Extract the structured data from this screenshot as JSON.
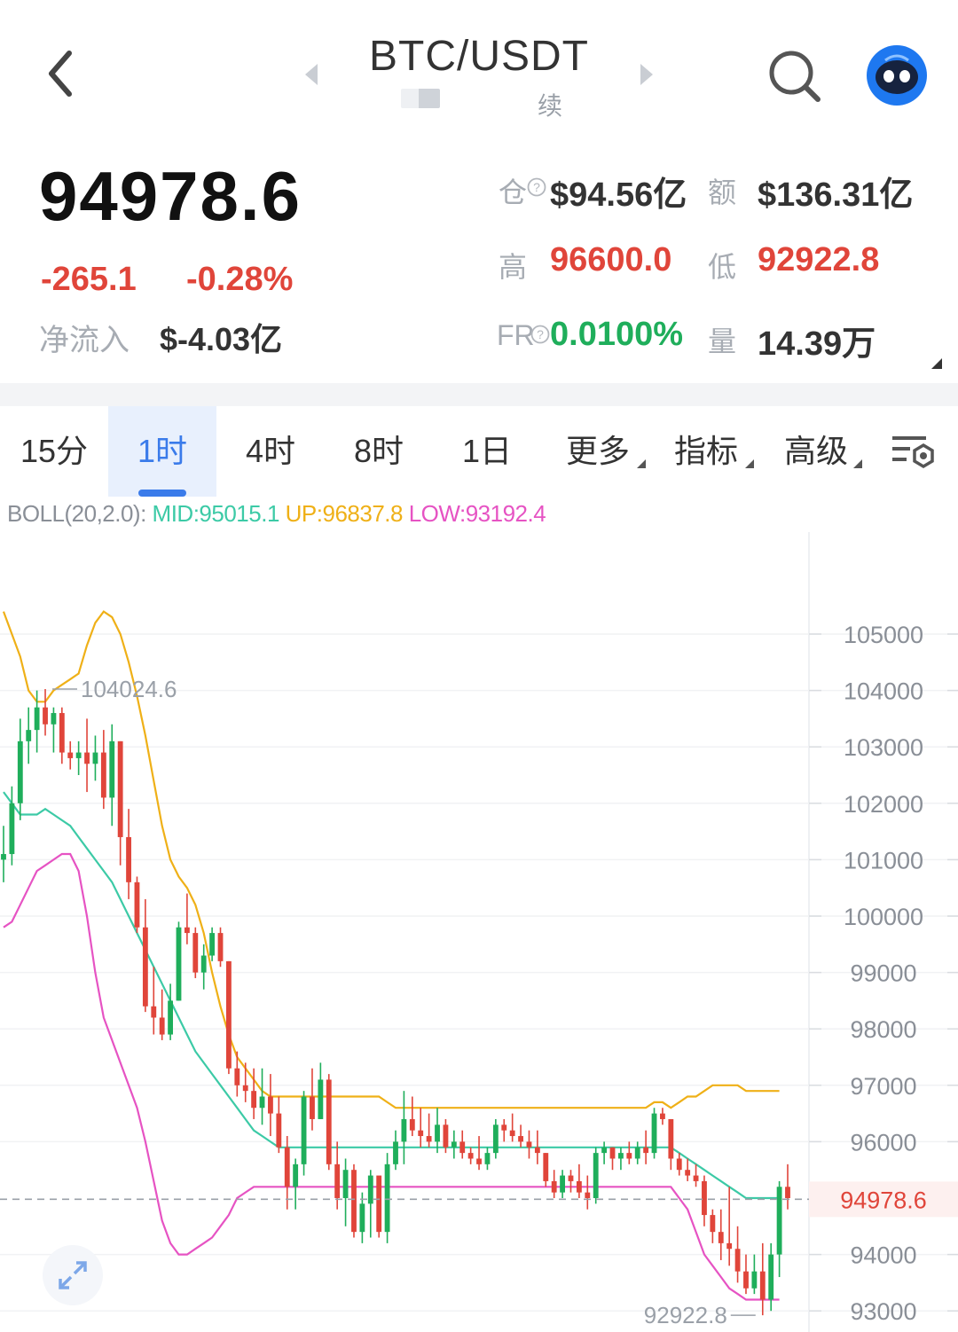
{
  "header": {
    "pair": "BTC/USDT",
    "sub_label": "续",
    "icons": {
      "back": "back-chevron-icon",
      "prev": "caret-left-icon",
      "next": "caret-right-icon",
      "search": "search-icon",
      "assistant": "robot-assistant-icon"
    }
  },
  "ticker": {
    "price": "94978.6",
    "change": "-265.1",
    "change_pct": "-0.28%",
    "inflow_label": "净流入",
    "inflow_value": "$-4.03亿",
    "oi_label": "仓",
    "oi_value": "$94.56亿",
    "amount_label": "额",
    "amount_value": "$136.31亿",
    "high_label": "高",
    "high_value": "96600.0",
    "low_label": "低",
    "low_value": "92922.8",
    "fr_label": "FR",
    "fr_value": "0.0100%",
    "vol_label": "量",
    "vol_value": "14.39万"
  },
  "tabs": [
    {
      "label": "15分"
    },
    {
      "label": "1时",
      "active": true
    },
    {
      "label": "4时"
    },
    {
      "label": "8时"
    },
    {
      "label": "1日"
    },
    {
      "label": "更多"
    },
    {
      "label": "指标"
    },
    {
      "label": "高级"
    }
  ],
  "indicator": {
    "name": "BOLL(20,2.0):",
    "mid": "MID:95015.1",
    "up": "UP:96837.8",
    "low": "LOW:93192.4"
  },
  "colors": {
    "up": "#1fae5b",
    "down": "#e0453a",
    "mid": "#3ccaa6",
    "upper": "#efb017",
    "lower": "#e653c3",
    "accent": "#3a7bea"
  },
  "chart_data": {
    "type": "candlestick",
    "y_ticks": [
      "105000",
      "104000",
      "103000",
      "102000",
      "101000",
      "100000",
      "99000",
      "98000",
      "97000",
      "96000",
      "94000",
      "93000"
    ],
    "ylim": [
      92800,
      105700
    ],
    "last_price_label": "94978.6",
    "last_price": 94978.6,
    "max_label": "104024.6",
    "max_value": 104024.6,
    "min_label": "92922.8",
    "min_value": 92922.8,
    "candles": [
      [
        101000,
        101600,
        100600,
        101100
      ],
      [
        101100,
        102300,
        100900,
        102000
      ],
      [
        102000,
        103500,
        101700,
        103100
      ],
      [
        103100,
        103700,
        102700,
        103300
      ],
      [
        103300,
        104000,
        102900,
        103700
      ],
      [
        103700,
        104024.6,
        103200,
        103400
      ],
      [
        103400,
        103700,
        102900,
        103600
      ],
      [
        103600,
        103700,
        102700,
        102900
      ],
      [
        102900,
        103100,
        102600,
        102800
      ],
      [
        102800,
        103100,
        102500,
        102900
      ],
      [
        102900,
        103500,
        102200,
        102700
      ],
      [
        102700,
        103200,
        102400,
        102900
      ],
      [
        102900,
        103300,
        101900,
        102100
      ],
      [
        102100,
        103400,
        101600,
        103100
      ],
      [
        103100,
        103100,
        100900,
        101400
      ],
      [
        101400,
        101900,
        100300,
        100600
      ],
      [
        100600,
        100700,
        99700,
        99800
      ],
      [
        99800,
        100300,
        98300,
        98400
      ],
      [
        98400,
        99100,
        97900,
        98200
      ],
      [
        98200,
        98700,
        97800,
        97900
      ],
      [
        97900,
        98800,
        97800,
        98500
      ],
      [
        98500,
        99900,
        98500,
        99800
      ],
      [
        99800,
        100400,
        99500,
        99700
      ],
      [
        99700,
        99800,
        98900,
        99000
      ],
      [
        99000,
        99500,
        98700,
        99300
      ],
      [
        99300,
        99800,
        99200,
        99700
      ],
      [
        99700,
        99800,
        99100,
        99200
      ],
      [
        99200,
        99200,
        97200,
        97300
      ],
      [
        97300,
        97600,
        96800,
        97000
      ],
      [
        97000,
        97400,
        96700,
        96900
      ],
      [
        96900,
        97300,
        96400,
        96600
      ],
      [
        96600,
        97300,
        96300,
        96800
      ],
      [
        96800,
        97200,
        96100,
        96500
      ],
      [
        96500,
        96800,
        95800,
        95900
      ],
      [
        95900,
        96100,
        94800,
        95200
      ],
      [
        95200,
        95700,
        94800,
        95600
      ],
      [
        95600,
        96900,
        95400,
        96800
      ],
      [
        96800,
        97300,
        96200,
        96400
      ],
      [
        96400,
        97400,
        96400,
        97100
      ],
      [
        97100,
        97200,
        95500,
        95600
      ],
      [
        95600,
        96000,
        94800,
        95000
      ],
      [
        95000,
        95700,
        94500,
        95500
      ],
      [
        95500,
        95600,
        94300,
        94400
      ],
      [
        94400,
        95100,
        94200,
        94900
      ],
      [
        94900,
        95500,
        94300,
        95400
      ],
      [
        95400,
        95300,
        94300,
        94400
      ],
      [
        94400,
        95800,
        94200,
        95600
      ],
      [
        95600,
        96200,
        95500,
        96000
      ],
      [
        96000,
        96900,
        95600,
        96400
      ],
      [
        96400,
        96800,
        96100,
        96200
      ],
      [
        96200,
        96600,
        95900,
        96100
      ],
      [
        96100,
        96500,
        95900,
        96000
      ],
      [
        96000,
        96600,
        95800,
        96300
      ],
      [
        96300,
        96400,
        95800,
        95900
      ],
      [
        95900,
        96200,
        95700,
        96000
      ],
      [
        96000,
        96200,
        95700,
        95800
      ],
      [
        95800,
        95900,
        95600,
        95700
      ],
      [
        95700,
        96100,
        95500,
        95600
      ],
      [
        95600,
        95900,
        95500,
        95800
      ],
      [
        95800,
        96400,
        95700,
        96300
      ],
      [
        96300,
        96400,
        96000,
        96200
      ],
      [
        96200,
        96500,
        96000,
        96100
      ],
      [
        96100,
        96300,
        95900,
        96000
      ],
      [
        96000,
        96200,
        95700,
        95900
      ],
      [
        95900,
        96200,
        95600,
        95800
      ],
      [
        95800,
        95800,
        95200,
        95300
      ],
      [
        95300,
        95500,
        95000,
        95100
      ],
      [
        95100,
        95500,
        95000,
        95400
      ],
      [
        95400,
        95500,
        95100,
        95300
      ],
      [
        95300,
        95600,
        95000,
        95100
      ],
      [
        95100,
        95400,
        94800,
        95000
      ],
      [
        95000,
        95900,
        94900,
        95800
      ],
      [
        95800,
        96000,
        95600,
        95900
      ],
      [
        95900,
        95900,
        95500,
        95700
      ],
      [
        95700,
        95900,
        95500,
        95800
      ],
      [
        95800,
        96000,
        95600,
        95700
      ],
      [
        95700,
        96000,
        95600,
        95900
      ],
      [
        95900,
        96200,
        95600,
        95800
      ],
      [
        95800,
        96600,
        95700,
        96500
      ],
      [
        96500,
        96600,
        96300,
        96400
      ],
      [
        96400,
        96400,
        95500,
        95700
      ],
      [
        95700,
        95800,
        95400,
        95500
      ],
      [
        95500,
        95700,
        95300,
        95400
      ],
      [
        95400,
        95600,
        95200,
        95300
      ],
      [
        95300,
        95400,
        94500,
        94700
      ],
      [
        94700,
        94800,
        94200,
        94400
      ],
      [
        94400,
        94800,
        93900,
        94200
      ],
      [
        94200,
        95200,
        93800,
        94100
      ],
      [
        94100,
        94500,
        93500,
        93700
      ],
      [
        93700,
        94000,
        93300,
        93400
      ],
      [
        93400,
        94000,
        93300,
        93700
      ],
      [
        93700,
        94200,
        92922.8,
        93200
      ],
      [
        93200,
        94200,
        93000,
        94000
      ],
      [
        94000,
        95300,
        93600,
        95200
      ],
      [
        95200,
        95600,
        94800,
        95000
      ]
    ],
    "mid": [
      102200,
      102000,
      101800,
      101800,
      101800,
      101900,
      101800,
      101700,
      101600,
      101400,
      101200,
      101000,
      100800,
      100600,
      100300,
      100000,
      99700,
      99400,
      99100,
      98800,
      98500,
      98200,
      97900,
      97600,
      97400,
      97200,
      97000,
      96800,
      96600,
      96400,
      96200,
      96100,
      96000,
      95900,
      95900,
      95900,
      95900,
      95900,
      95900,
      95900,
      95900,
      95900,
      95900,
      95900,
      95900,
      95900,
      95900,
      95900,
      95900,
      95900,
      95900,
      95900,
      95900,
      95900,
      95900,
      95900,
      95900,
      95900,
      95900,
      95900,
      95900,
      95900,
      95900,
      95900,
      95900,
      95900,
      95900,
      95900,
      95900,
      95900,
      95900,
      95900,
      95900,
      95900,
      95900,
      95900,
      95900,
      95900,
      95900,
      95900,
      95900,
      95800,
      95700,
      95600,
      95500,
      95400,
      95300,
      95200,
      95100,
      95000,
      95000,
      95000,
      95000,
      95000
    ],
    "upper": [
      105400,
      105000,
      104600,
      104000,
      103800,
      103800,
      104000,
      104100,
      104200,
      104300,
      104800,
      105200,
      105400,
      105300,
      105000,
      104500,
      103900,
      103200,
      102400,
      101600,
      101000,
      100700,
      100500,
      100200,
      99700,
      99000,
      98400,
      97900,
      97500,
      97300,
      97100,
      96900,
      96800,
      96800,
      96800,
      96800,
      96800,
      96800,
      96800,
      96800,
      96800,
      96800,
      96800,
      96800,
      96800,
      96800,
      96700,
      96600,
      96600,
      96600,
      96600,
      96600,
      96600,
      96600,
      96600,
      96600,
      96600,
      96600,
      96600,
      96600,
      96600,
      96600,
      96600,
      96600,
      96600,
      96600,
      96600,
      96600,
      96600,
      96600,
      96600,
      96600,
      96600,
      96600,
      96600,
      96600,
      96600,
      96600,
      96700,
      96700,
      96600,
      96700,
      96800,
      96800,
      96900,
      97000,
      97000,
      97000,
      97000,
      96900,
      96900,
      96900,
      96900,
      96900
    ],
    "lower": [
      99800,
      99900,
      100200,
      100500,
      100800,
      100900,
      101000,
      101100,
      101100,
      100800,
      100000,
      99000,
      98200,
      97800,
      97400,
      97000,
      96600,
      96000,
      95300,
      94600,
      94200,
      94000,
      94000,
      94100,
      94200,
      94300,
      94500,
      94700,
      95000,
      95100,
      95200,
      95200,
      95200,
      95200,
      95200,
      95200,
      95200,
      95200,
      95200,
      95200,
      95200,
      95200,
      95200,
      95200,
      95200,
      95200,
      95200,
      95200,
      95200,
      95200,
      95200,
      95200,
      95200,
      95200,
      95200,
      95200,
      95200,
      95200,
      95200,
      95200,
      95200,
      95200,
      95200,
      95200,
      95200,
      95200,
      95200,
      95200,
      95200,
      95200,
      95200,
      95200,
      95200,
      95200,
      95200,
      95200,
      95200,
      95200,
      95200,
      95200,
      95200,
      95000,
      94800,
      94400,
      94000,
      93800,
      93600,
      93400,
      93300,
      93200,
      93200,
      93200,
      93200,
      93200
    ]
  }
}
